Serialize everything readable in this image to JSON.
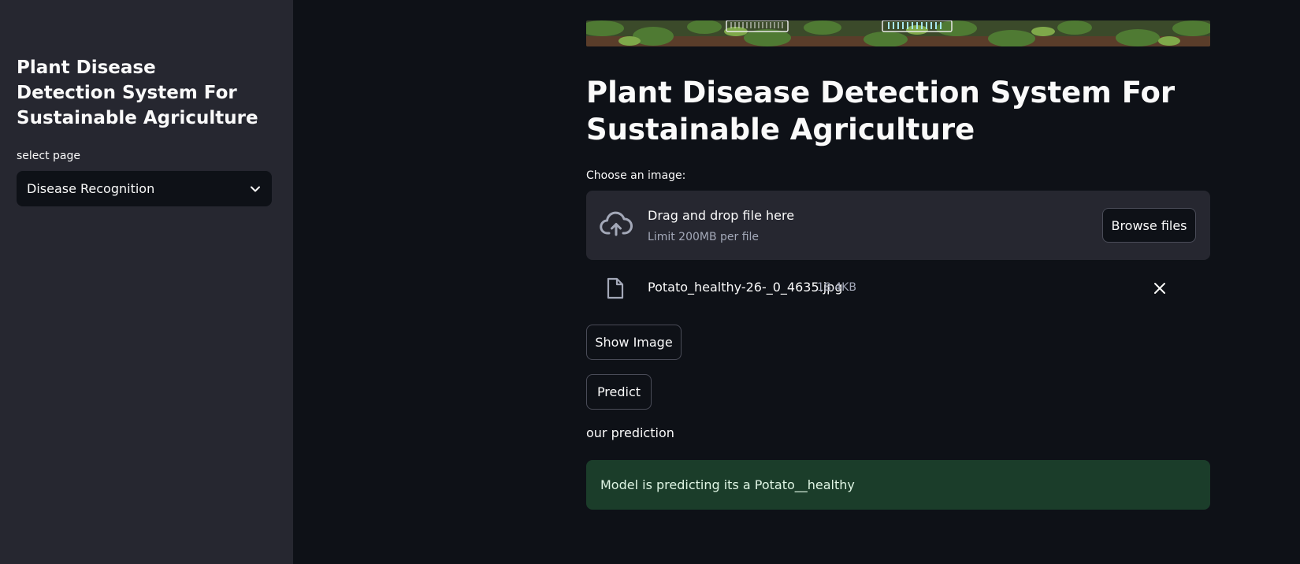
{
  "sidebar": {
    "title": "Plant Disease Detection System For Sustainable Agriculture",
    "select_label": "select page",
    "select_value": "Disease Recognition"
  },
  "main": {
    "title": "Plant Disease Detection System For Sustainable Agriculture",
    "uploader": {
      "label": "Choose an image:",
      "drag_text": "Drag and drop file here",
      "limit_text": "Limit 200MB per file",
      "browse_label": "Browse files"
    },
    "uploaded_file": {
      "name": "Potato_healthy-26-_0_4635.jpg",
      "size": "18.4KB"
    },
    "show_image_label": "Show Image",
    "predict_label": "Predict",
    "prediction_heading": "our prediction",
    "prediction_result": "Model is predicting its a Potato__healthy"
  },
  "colors": {
    "background": "#0e1117",
    "sidebar": "#262730",
    "success_bg": "#1b3d2a",
    "muted_text": "#a3a8b8"
  },
  "icons": {
    "select_chevron": "chevron-down-icon",
    "upload": "cloud-upload-icon",
    "file": "file-icon",
    "remove": "close-icon"
  }
}
